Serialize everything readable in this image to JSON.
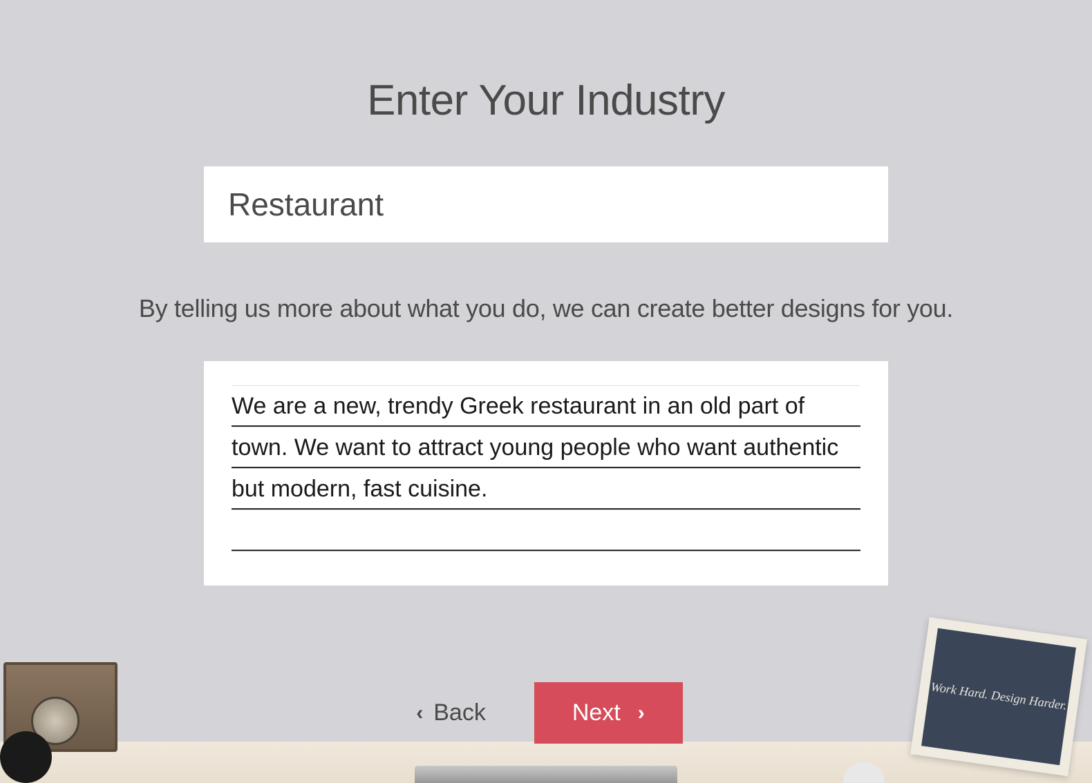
{
  "heading": "Enter Your Industry",
  "industry": {
    "value": "Restaurant"
  },
  "subtitle": "By telling us more about what you do, we can create better designs for you.",
  "description": {
    "value": "We are a new, trendy Greek restaurant in an old part of town. We want to attract young people who want authentic but modern, fast cuisine."
  },
  "buttons": {
    "back_label": "Back",
    "next_label": "Next"
  },
  "decor": {
    "frame_text": "Work Hard.\nDesign Harder."
  }
}
